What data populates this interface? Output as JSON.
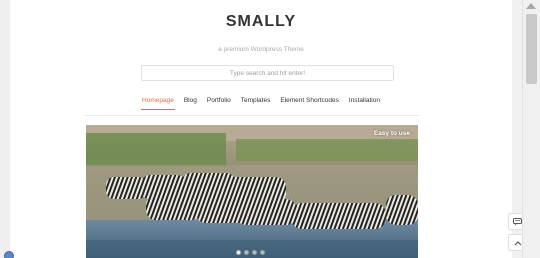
{
  "site": {
    "title": "SMALLY",
    "tagline": "a premium Wordpress Theme"
  },
  "search": {
    "placeholder": "Type search and hit enter!"
  },
  "nav": {
    "items": [
      {
        "label": "Homepage",
        "active": true
      },
      {
        "label": "Blog",
        "active": false
      },
      {
        "label": "Portfolio",
        "active": false
      },
      {
        "label": "Templates",
        "active": false
      },
      {
        "label": "Element Shortcodes",
        "active": false
      },
      {
        "label": "Installation",
        "active": false
      }
    ]
  },
  "slider": {
    "caption": "Easy to use",
    "slide_count": 4,
    "active_slide": 1
  },
  "floating_buttons": {
    "comment_icon": "comment-icon",
    "back_to_top_icon": "chevron-up-icon"
  },
  "colors": {
    "accent": "#e86a4a",
    "text": "#333333",
    "muted": "#aaaaaa"
  }
}
